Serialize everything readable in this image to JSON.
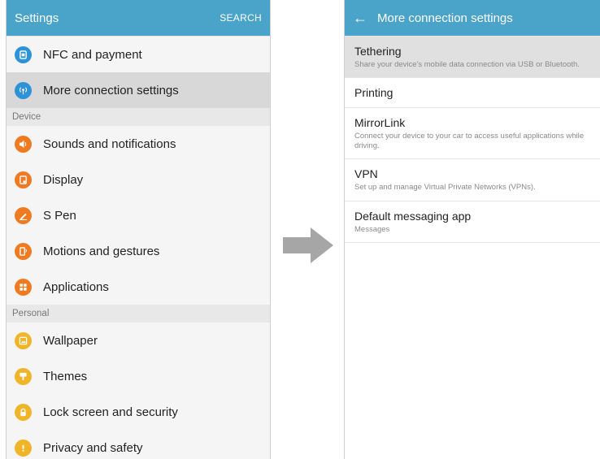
{
  "left": {
    "title": "Settings",
    "action": "SEARCH",
    "rows": [
      {
        "type": "item",
        "label": "NFC and payment",
        "icon": "nfc-icon",
        "color": "#2e92d6",
        "selected": false
      },
      {
        "type": "item",
        "label": "More connection settings",
        "icon": "connection-icon",
        "color": "#2e92d6",
        "selected": true
      },
      {
        "type": "section",
        "label": "Device"
      },
      {
        "type": "item",
        "label": "Sounds and notifications",
        "icon": "sound-icon",
        "color": "#ee7a22",
        "selected": false
      },
      {
        "type": "item",
        "label": "Display",
        "icon": "display-icon",
        "color": "#ee7a22",
        "selected": false
      },
      {
        "type": "item",
        "label": "S Pen",
        "icon": "pen-icon",
        "color": "#ee7a22",
        "selected": false
      },
      {
        "type": "item",
        "label": "Motions and gestures",
        "icon": "motion-icon",
        "color": "#ee7a22",
        "selected": false
      },
      {
        "type": "item",
        "label": "Applications",
        "icon": "apps-icon",
        "color": "#ee7a22",
        "selected": false
      },
      {
        "type": "section",
        "label": "Personal"
      },
      {
        "type": "item",
        "label": "Wallpaper",
        "icon": "wallpaper-icon",
        "color": "#f0b429",
        "selected": false
      },
      {
        "type": "item",
        "label": "Themes",
        "icon": "themes-icon",
        "color": "#f0b429",
        "selected": false
      },
      {
        "type": "item",
        "label": "Lock screen and security",
        "icon": "lock-icon",
        "color": "#f0b429",
        "selected": false
      },
      {
        "type": "item",
        "label": "Privacy and safety",
        "icon": "privacy-icon",
        "color": "#f0b429",
        "selected": false
      }
    ]
  },
  "right": {
    "title": "More connection settings",
    "back_icon": "back-arrow-icon",
    "items": [
      {
        "title": "Tethering",
        "subtitle": "Share your device's mobile data connection via USB or Bluetooth.",
        "selected": true
      },
      {
        "title": "Printing",
        "subtitle": "",
        "selected": false
      },
      {
        "title": "MirrorLink",
        "subtitle": "Connect your device to your car to access useful applications while driving.",
        "selected": false
      },
      {
        "title": "VPN",
        "subtitle": "Set up and manage Virtual Private Networks (VPNs).",
        "selected": false
      },
      {
        "title": "Default messaging app",
        "subtitle": "Messages",
        "selected": false
      }
    ]
  },
  "colors": {
    "appbar": "#4aa3c9",
    "arrow": "#a6a6a6"
  }
}
